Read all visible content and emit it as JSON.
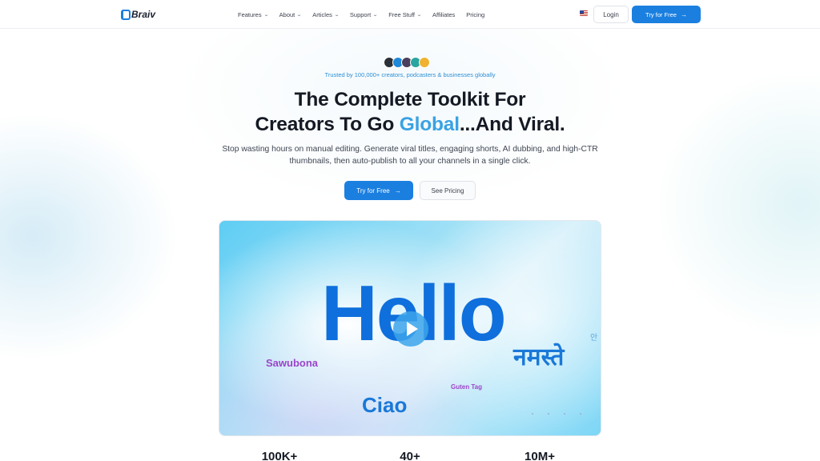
{
  "nav": {
    "logo_text": "Braiv",
    "links": [
      {
        "label": "Features",
        "dropdown": true
      },
      {
        "label": "About",
        "dropdown": true
      },
      {
        "label": "Articles",
        "dropdown": true
      },
      {
        "label": "Support",
        "dropdown": true
      },
      {
        "label": "Free Stuff",
        "dropdown": true
      },
      {
        "label": "Affiliates",
        "dropdown": false
      },
      {
        "label": "Pricing",
        "dropdown": false
      }
    ],
    "locale_flag": "us-flag-icon",
    "login_label": "Login",
    "cta_label": "Try for Free"
  },
  "hero": {
    "trusted_text": "Trusted by 100,000+ creators, podcasters & businesses globally",
    "headline_line1": "The Complete Toolkit For",
    "headline_line2_pre": "Creators To Go ",
    "headline_accent": "Global",
    "headline_line2_post": "...And Viral.",
    "subtext": "Stop wasting hours on manual editing. Generate viral titles, engaging shorts, AI dubbing, and high-CTR thumbnails, then auto-publish to all your channels in a single click.",
    "primary_cta": "Try for Free",
    "secondary_cta": "See Pricing",
    "avatar_colors": [
      "#2b2f36",
      "#1e88d9",
      "#4a3f5c",
      "#2aa5a0",
      "#f0b232"
    ]
  },
  "video": {
    "words": {
      "hello": "Hello",
      "namaste": "नमस्ते",
      "sawubona": "Sawubona",
      "guten_tag": "Guten Tag",
      "ciao": "Ciao",
      "annyeong": "안"
    },
    "play_icon": "play-icon"
  },
  "stats": [
    {
      "value": "100K+"
    },
    {
      "value": "40+"
    },
    {
      "value": "10M+"
    }
  ],
  "colors": {
    "accent": "#1b7fe0",
    "headline_accent": "#3aa2e3",
    "trusted_text": "#2d8fd6"
  }
}
